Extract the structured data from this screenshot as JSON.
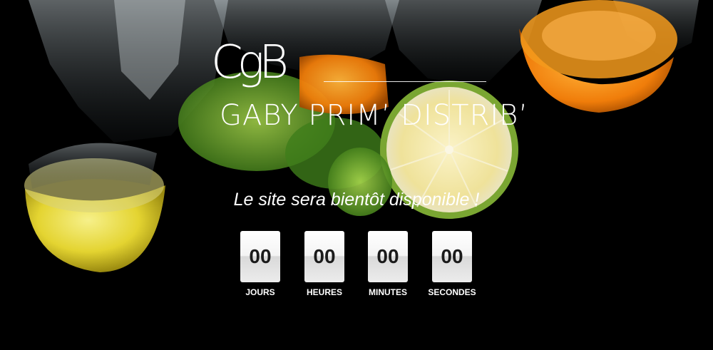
{
  "hero": {
    "background_image": "citrus-fruits-splashing-in-water",
    "background_color": "#000000"
  },
  "brand": {
    "monogram": "CgB",
    "name": "GABY PRIM’ DISTRIB’"
  },
  "tagline": "Le site sera bientôt disponible !",
  "countdown": {
    "units": [
      {
        "value": "00",
        "label": "JOURS"
      },
      {
        "value": "00",
        "label": "HEURES"
      },
      {
        "value": "00",
        "label": "MINUTES"
      },
      {
        "value": "00",
        "label": "SECONDES"
      }
    ]
  }
}
